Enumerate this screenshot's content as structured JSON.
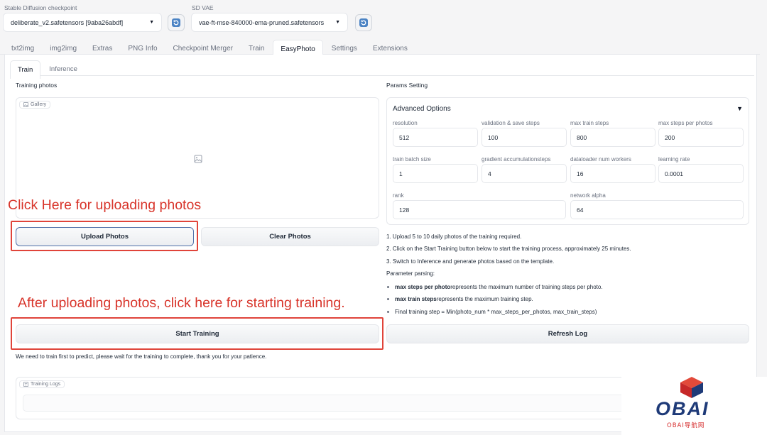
{
  "header": {
    "checkpoint_label": "Stable Diffusion checkpoint",
    "checkpoint_value": "deliberate_v2.safetensors [9aba26abdf]",
    "vae_label": "SD VAE",
    "vae_value": "vae-ft-mse-840000-ema-pruned.safetensors"
  },
  "main_tabs": [
    "txt2img",
    "img2img",
    "Extras",
    "PNG Info",
    "Checkpoint Merger",
    "Train",
    "EasyPhoto",
    "Settings",
    "Extensions"
  ],
  "sub_tabs": [
    "Train",
    "Inference"
  ],
  "left": {
    "section_title": "Training photos",
    "gallery_label": "Gallery",
    "upload_button": "Upload Photos",
    "clear_button": "Clear Photos",
    "start_button": "Start Training",
    "wait_note": "We need to train first to predict, please wait for the training to complete, thank you for your patience.",
    "logs_label": "Training Logs"
  },
  "right": {
    "section_title": "Params Setting",
    "accordion_title": "Advanced Options",
    "params": [
      {
        "label": "resolution",
        "value": "512"
      },
      {
        "label": "validation & save steps",
        "value": "100"
      },
      {
        "label": "max train steps",
        "value": "800"
      },
      {
        "label": "max steps per photos",
        "value": "200"
      },
      {
        "label": "train batch size",
        "value": "1"
      },
      {
        "label": "gradient accumulationsteps",
        "value": "4"
      },
      {
        "label": "dataloader num workers",
        "value": "16"
      },
      {
        "label": "learning rate",
        "value": "0.0001"
      },
      {
        "label": "rank",
        "value": "128"
      },
      {
        "label": "network alpha",
        "value": "64"
      }
    ],
    "instructions": [
      "1. Upload 5 to 10 daily photos of the training required.",
      "2. Click on the Start Training button below to start the training process, approximately 25 minutes.",
      "3. Switch to Inference and generate photos based on the template."
    ],
    "parsing_title": "Parameter parsing:",
    "bullets": [
      {
        "bold": "max steps per photo",
        "rest": " represents the maximum number of training steps per photo."
      },
      {
        "bold": "max train steps",
        "rest": " represents the maximum training step."
      },
      {
        "bold": "",
        "rest": "Final training step = Min(photo_num * max_steps_per_photos, max_train_steps)"
      }
    ],
    "refresh_button": "Refresh Log"
  },
  "annotations": {
    "upload_hint": "Click Here for uploading photos",
    "train_hint": "After uploading photos, click here for starting training."
  },
  "watermark": {
    "logo_text": "OBAI",
    "sub_text": "OBAI导航网"
  },
  "colors": {
    "annotation_red": "#d8342a",
    "logo_red": "#d62f2f",
    "logo_blue": "#1e3a78"
  }
}
